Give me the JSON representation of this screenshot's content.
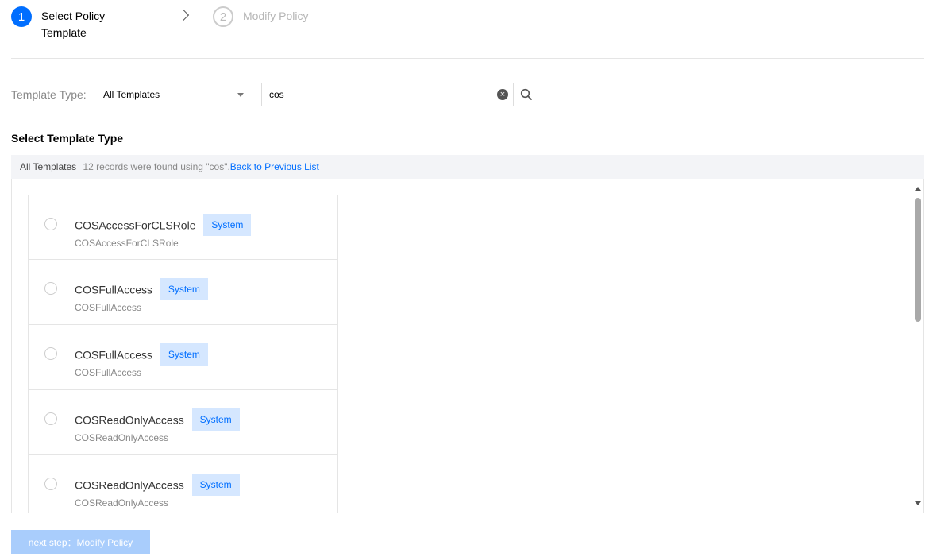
{
  "steps": [
    {
      "number": "1",
      "label": "Select Policy Template"
    },
    {
      "number": "2",
      "label": "Modify Policy"
    }
  ],
  "filter": {
    "label": "Template Type:",
    "selected_type": "All Templates",
    "search_value": "cos"
  },
  "section_title": "Select Template Type",
  "list_header": {
    "category": "All Templates",
    "result_text": "12 records were found using \"cos\".",
    "back_link": "Back to Previous List"
  },
  "templates": [
    {
      "name": "COSAccessForCLSRole",
      "badge": "System",
      "description": "COSAccessForCLSRole"
    },
    {
      "name": "COSFullAccess",
      "badge": "System",
      "description": "COSFullAccess"
    },
    {
      "name": "COSFullAccess",
      "badge": "System",
      "description": "COSFullAccess"
    },
    {
      "name": "COSReadOnlyAccess",
      "badge": "System",
      "description": "COSReadOnlyAccess"
    },
    {
      "name": "COSReadOnlyAccess",
      "badge": "System",
      "description": "COSReadOnlyAccess"
    }
  ],
  "next_button": "next step：Modify Policy",
  "colors": {
    "accent": "#006eff",
    "badge_bg": "#d5e7ff",
    "disabled_button": "#a9cdfc"
  },
  "icons": {
    "step_separator": "chevron-right-icon",
    "dropdown": "caret-down-icon",
    "clear": "clear-icon",
    "search": "search-icon"
  }
}
